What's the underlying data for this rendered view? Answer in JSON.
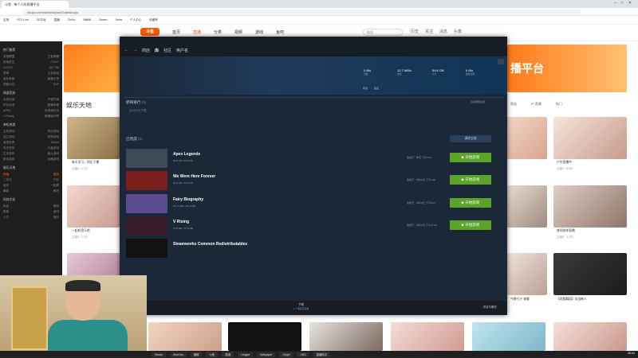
{
  "browser": {
    "tab_title": "斗鱼 - 每个人的直播平台",
    "url": "douyu.com/directory/subCate/douyu",
    "bookmarks": [
      "应用",
      "RTX Live",
      "3D平台",
      "直播",
      "ZhiHu",
      "BiliBili",
      "Steam",
      "Seria",
      "个人中心",
      "收藏夹"
    ]
  },
  "site": {
    "logo": "斗鱼",
    "nav": [
      "首页",
      "直播",
      "分类",
      "视频",
      "游戏",
      "鱼吧"
    ],
    "search_placeholder": "搜索",
    "head_icons": [
      "历史",
      "关注",
      "消息",
      "头像"
    ],
    "section_title": "娱乐天地",
    "section_tools": [
      "筛选",
      "IP 直播",
      "热门"
    ],
    "banner_text": "播平台",
    "sidebar": {
      "sections": [
        {
          "title": "热门推荐",
          "rows": [
            [
              "英雄联盟",
              "王者荣耀"
            ],
            [
              "绝地求生",
              "CSGO"
            ],
            [
              "DOTA2",
              "QQ飞车"
            ],
            [
              "原神",
              "主机游戏"
            ],
            [
              "星际争霸",
              "魔兽世界"
            ],
            [
              "穿越火线",
              "DNF"
            ]
          ]
        },
        {
          "title": "网游竞技",
          "rows": [
            [
              "永劫无间",
              "守望先锋"
            ],
            [
              "炉石传说",
              "魔兽争霸"
            ],
            [
              "APEX",
              "逃离塔科夫"
            ],
            [
              "V Rising",
              "暗黑破坏神"
            ]
          ]
        },
        {
          "title": "单机热游",
          "rows": [
            [
              "主机游戏",
              "怀旧游戏"
            ],
            [
              "独立游戏",
              "恐怖游戏"
            ],
            [
              "我的世界",
              "Steam"
            ],
            [
              "天天吃鸡",
              "沙盒游戏"
            ],
            [
              "生存游戏",
              "格斗游戏"
            ],
            [
              "射击游戏",
              "战略游戏"
            ]
          ]
        },
        {
          "title": "娱乐天地",
          "rows": [
            [
              "颜值",
              "星秀"
            ],
            [
              "二次元",
              "户外"
            ],
            [
              "音乐",
              "一起看"
            ],
            [
              "舞蹈",
              "聊天"
            ]
          ]
        },
        {
          "title": "科技文化",
          "rows": [
            [
              "科技",
              "数码"
            ],
            [
              "教育",
              "读书"
            ],
            [
              "人文",
              "娱乐"
            ]
          ]
        }
      ]
    },
    "cards": [
      {
        "title": "每天学习，快乐下播",
        "sub": "主播A · 2.1万"
      },
      {
        "title": "一起听音乐吧",
        "sub": "主播B · 1.3万"
      },
      {
        "title": "户外直播中",
        "sub": "主播C · 8765"
      },
      {
        "title": "夜间陪伴直播",
        "sub": "主播D · 1.2万"
      },
      {
        "title": "今晚七夕 来聊",
        "sub": "主播E · 9821"
      },
      {
        "title": "【炫酷舞蹈】欢迎新人",
        "sub": "主播F · 5432"
      }
    ]
  },
  "steam": {
    "nav": [
      "商店",
      "库",
      "社区",
      "用户名"
    ],
    "stats": [
      {
        "value": "0 B/s",
        "label": "当前"
      },
      {
        "value": "12.7 MB/s",
        "label": "峰值"
      },
      {
        "value": "59.6 GB",
        "label": "总计"
      },
      {
        "value": "0 B/s",
        "label": "磁盘使用"
      }
    ],
    "legend": [
      "网络",
      "磁盘"
    ],
    "upcoming_heading": "即将进行",
    "upcoming_count": "(0)",
    "upcoming_empty": "队列中无下载",
    "auto_update_label": "自动更新设置",
    "done_heading": "已完成",
    "done_count": "(5)",
    "clear_all": "清除全部",
    "games": [
      {
        "name": "Apex Legends",
        "size": "56.8 GB / 56.8 GB",
        "time": "完成于：昨天 下午4:44",
        "play": "开始游戏",
        "color": "#3f4a57"
      },
      {
        "name": "We Were Here Forever",
        "size": "24.6 GB / 24.6 GB",
        "time": "完成于：9月18日 下午4:19",
        "play": "开始游戏",
        "color": "#7a1d1d"
      },
      {
        "name": "Fairy Biography",
        "size": "161.9 MB / 161.9 MB",
        "time": "完成于：9月10日 下午8:23",
        "play": "开始游戏",
        "color": "#5a4c8f"
      },
      {
        "name": "V Rising",
        "size": "75.8 MB / 75.8 MB",
        "time": "完成于：9月10日 下午10:18",
        "play": "开始游戏",
        "color": "#3a1d2a"
      },
      {
        "name": "Steamworks Common Redistributables",
        "size": "",
        "time": "",
        "play": "",
        "color": "#111111"
      }
    ],
    "downloads_label": "下载",
    "downloads_sub": "1 个项目已完成",
    "friends_label": "好友与聊天"
  },
  "taskbar": {
    "items": [
      "Steam",
      "GiraGira",
      "编辑",
      "斗鱼",
      "英雄",
      "League",
      "Wallpaper",
      "Origin",
      "OBS",
      "直播助手"
    ],
    "clock": "16:44"
  }
}
